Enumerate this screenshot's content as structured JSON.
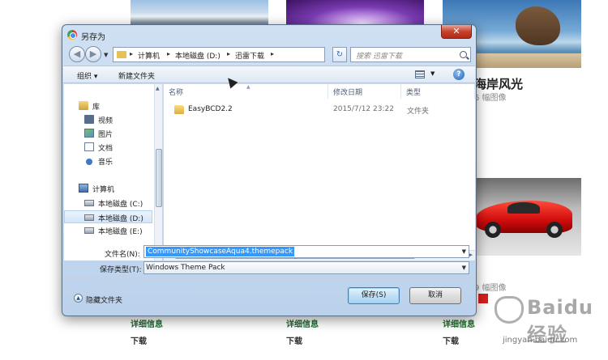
{
  "background": {
    "coast_title": "海岸风光",
    "coast_count": "6 幅图像",
    "car_count": "9 幅图像",
    "detail_link": "详细信息",
    "download_link": "下载",
    "watermark": "Baidu 经验",
    "watermark_url": "jingyan.baidu.com"
  },
  "dialog": {
    "title": "另存为",
    "close": "✕",
    "address": {
      "seg1": "计算机",
      "seg2": "本地磁盘 (D:)",
      "seg3": "迅雷下载"
    },
    "search_placeholder": "搜索 迅雷下载",
    "toolbar": {
      "organize": "组织 ▾",
      "new_folder": "新建文件夹",
      "help": "?"
    },
    "sidebar": {
      "library": "库",
      "video": "视频",
      "pictures": "图片",
      "documents": "文档",
      "music": "音乐",
      "computer": "计算机",
      "disk_c": "本地磁盘 (C:)",
      "disk_d": "本地磁盘 (D:)",
      "disk_e": "本地磁盘 (E:)"
    },
    "columns": {
      "name": "名称",
      "date": "修改日期",
      "type": "类型"
    },
    "files": [
      {
        "name": "EasyBCD2.2",
        "date": "2015/7/12 23:22",
        "type": "文件夹"
      }
    ],
    "filename_label": "文件名(N):",
    "filename_value": "CommunityShowcaseAqua4.themepack",
    "filetype_label": "保存类型(T):",
    "filetype_value": "Windows Theme Pack",
    "hide_folders": "隐藏文件夹",
    "save_button": "保存(S)",
    "cancel_button": "取消"
  },
  "colors": {
    "accent": "#3399ff",
    "link_green": "#1d6a2c"
  }
}
